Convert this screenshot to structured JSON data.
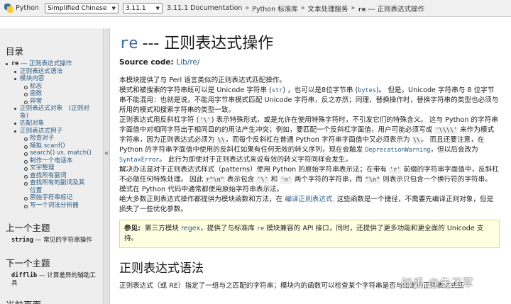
{
  "topbar": {
    "app": "Python",
    "language": "Simplified Chinese",
    "version": "3.11.1",
    "crumbs": [
      "3.11.1 Documentation",
      "Python 标准库",
      "文本处理服务",
      "re",
      "--- 正则表达式操作"
    ],
    "separator": "»"
  },
  "sidebar": {
    "toc_heading": "目录",
    "toc": [
      {
        "mono": "re",
        "text": " --- 正则表达式操作",
        "level": 0
      },
      {
        "text": "正则表达式语法",
        "level": 1
      },
      {
        "text": "模块内容",
        "level": 1
      },
      {
        "text": "标志",
        "level": 2
      },
      {
        "text": "函数",
        "level": 2
      },
      {
        "text": "异常",
        "level": 2
      },
      {
        "text": "正则表达式对象　(正则对",
        "level": 1
      },
      {
        "text": "象)",
        "level": 1,
        "cont": true
      },
      {
        "text": "匹配对象",
        "level": 1
      },
      {
        "text": "正则表达式例子",
        "level": 1
      },
      {
        "text": "检查对子",
        "level": 2
      },
      {
        "text": "模拟 scanf()",
        "level": 2
      },
      {
        "text": "search() vs. match()",
        "level": 2
      },
      {
        "text": "制作一个电话本",
        "level": 2
      },
      {
        "text": "文字整理",
        "level": 2
      },
      {
        "text": "查找所有副词",
        "level": 2
      },
      {
        "text": "查找所有的副词及其",
        "level": 2
      },
      {
        "text": "位置",
        "level": 2,
        "cont": true
      },
      {
        "text": "原始字符串标记",
        "level": 2
      },
      {
        "text": "写一个词法分析器",
        "level": 2
      }
    ],
    "prev_heading": "上一个主题",
    "prev_mono": "string",
    "prev_text": " — 常见的字符串操作",
    "next_heading": "下一个主题",
    "next_mono": "difflib",
    "next_text": " — 计算差异的辅助工",
    "next_text2": "具",
    "page_heading": "当前页面",
    "collapse": "«"
  },
  "main": {
    "title_mono": "re",
    "title_text": "--- 正则表达式操作",
    "source_label": "Source code: ",
    "source_link": "Lib/re/",
    "p1": "本模块提供了与 Perl 语言类似的正则表达式匹配操作。",
    "p2a": "模式和被搜索的字符串既可以是 Unicode 字符串 (",
    "p2_str": "str",
    "p2b": ") ，也可以是8位字节串 (",
    "p2_bytes": "bytes",
    "p2c": ")。 但是，Unicode 字符串与 8 位字节串不能混用：也就是说，不能用字节串模式匹配 Unicode 字符串，反之亦然；同理，替换操作时，替换字符串的类型也必须与所用的模式和搜索字符串的类型一致。",
    "p3a": "正则表达式用反斜杠字符 (",
    "p3_bs": "'\\'",
    "p3b": ") 表示特殊形式，或是允许在使用特殊字符时，不引发它们的特殊含义。 这与 Python 的字符串字面值中对相同字符出于相同目的的用法产生冲突；例如，要匹配一个反斜杠字面值，用户可能必须写成 ",
    "p3_4bs": "'\\\\\\\\'",
    "p3c": " 来作为模式字符串，因为正则表达式必须为 ",
    "p3_2bs": "\\\\",
    "p3d": "，而每个反斜杠在普通 Python 字符串字面值中又必须表示为 ",
    "p3_2bs2": "\\\\",
    "p3e": "。 而且还要注意，在 Python 的字符串字面值中使用的反斜杠如果有任何无效的转义序列，现在会触发 ",
    "p3_dep": "DeprecationWarning",
    "p3f": "，但以后会改为 ",
    "p3_syn": "SyntaxError",
    "p3g": "。 此行为即使对于正则表达式来说有效的转义字符同样会发生。",
    "p4a": "解决办法是对于正则表达式样式（patterns）使用 Python 的原始字符串表示法；在带有 ",
    "p4_r": "'r'",
    "p4b": " 前缀的字符串字面值中，反斜杠不必做任何特殊处理。 因此 ",
    "p4_rn": "r\"\\n\"",
    "p4c": " 表示包含 ",
    "p4_bs": "'\\'",
    "p4d": " 和 ",
    "p4_n": "'n'",
    "p4e": " 两个字符的字符串，而 ",
    "p4_nl": "\"\\n\"",
    "p4f": " 则表示只包含一个换行符的字符串。 模式在 Python 代码中通常都使用原始字符串表示法。",
    "p5a": "绝大多数正则表达式操作都提供为模块函数和方法，在 ",
    "p5_link": "编译正则表达式",
    "p5b": ". 这些函数是一个捷径，不需要先编译正则对象，但是损失了一些优化参数。",
    "seealso_label": "参见:",
    "seealso_a": "第三方模块 ",
    "seealso_link": "regex",
    "seealso_b": "，提供了与标准库 ",
    "seealso_re": "re",
    "seealso_c": " 模块兼容的 API 接口，同时，还提供了更多功能和更全面的 Unicode 支持。",
    "h2": "正则表达式语法",
    "last": "正则表达式（或 RE）指定了一组与之匹配的字符串；模块内的函数可以检查某个字符串是否与给定的正则表达式匹"
  },
  "watermark": "知乎 @朱卫军"
}
